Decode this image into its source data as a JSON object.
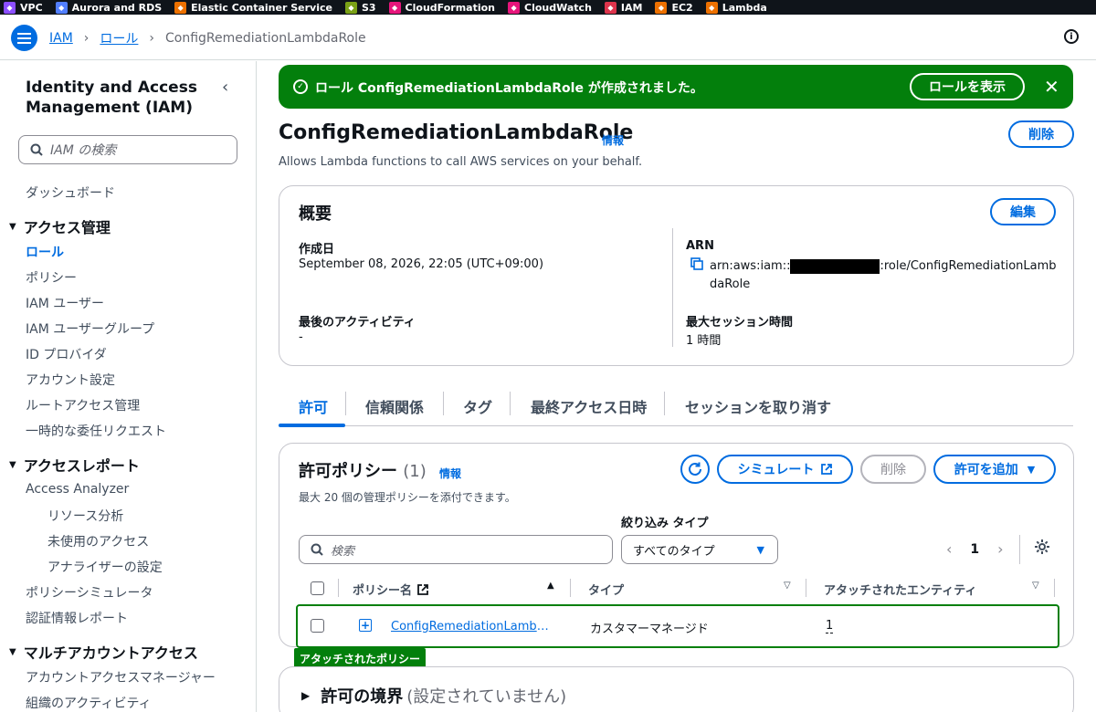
{
  "services": [
    {
      "name": "VPC",
      "color": "#8c4fff",
      "icon": "vpc-icon"
    },
    {
      "name": "Aurora and RDS",
      "color": "#527fff",
      "icon": "rds-icon"
    },
    {
      "name": "Elastic Container Service",
      "color": "#ed7100",
      "icon": "ecs-icon"
    },
    {
      "name": "S3",
      "color": "#7aa116",
      "icon": "s3-icon"
    },
    {
      "name": "CloudFormation",
      "color": "#e7157b",
      "icon": "cloudformation-icon"
    },
    {
      "name": "CloudWatch",
      "color": "#e7157b",
      "icon": "cloudwatch-icon"
    },
    {
      "name": "IAM",
      "color": "#dd344c",
      "icon": "iam-icon"
    },
    {
      "name": "EC2",
      "color": "#ed7100",
      "icon": "ec2-icon"
    },
    {
      "name": "Lambda",
      "color": "#ed7100",
      "icon": "lambda-icon"
    }
  ],
  "breadcrumb": {
    "iam": "IAM",
    "roles": "ロール",
    "current": "ConfigRemediationLambdaRole"
  },
  "sidebar": {
    "title": "Identity and Access Management (IAM)",
    "search_placeholder": "IAM の検索",
    "dashboard": "ダッシュボード",
    "access_mgmt": {
      "header": "アクセス管理",
      "items": [
        "ロール",
        "ポリシー",
        "IAM ユーザー",
        "IAM ユーザーグループ",
        "ID プロバイダ",
        "アカウント設定",
        "ルートアクセス管理",
        "一時的な委任リクエスト"
      ]
    },
    "access_reports": {
      "header": "アクセスレポート",
      "analyzer": "Access Analyzer",
      "analyzer_items": [
        "リソース分析",
        "未使用のアクセス",
        "アナライザーの設定"
      ],
      "items": [
        "ポリシーシミュレータ",
        "認証情報レポート"
      ]
    },
    "multi_account": {
      "header": "マルチアカウントアクセス",
      "items": [
        "アカウントアクセスマネージャー",
        "組織のアクティビティ"
      ]
    }
  },
  "flash": {
    "message": "ロール ConfigRemediationLambdaRole が作成されました。",
    "view_button": "ロールを表示",
    "color": "#037f0c"
  },
  "role": {
    "name": "ConfigRemediationLambdaRole",
    "info": "情報",
    "description": "Allows Lambda functions to call AWS services on your behalf.",
    "delete_button": "削除"
  },
  "summary": {
    "title": "概要",
    "edit_button": "編集",
    "created_label": "作成日",
    "created_value": "September 08, 2026, 22:05 (UTC+09:00)",
    "arn_label": "ARN",
    "arn_prefix": "arn:aws:iam::",
    "arn_suffix": ":role/ConfigRemediationLamb",
    "arn_suffix2": "daRole",
    "last_activity_label": "最後のアクティビティ",
    "last_activity_value": "-",
    "max_session_label": "最大セッション時間",
    "max_session_value": "1 時間"
  },
  "tabs": [
    "許可",
    "信頼関係",
    "タグ",
    "最終アクセス日時",
    "セッションを取り消す"
  ],
  "policies": {
    "title": "許可ポリシー",
    "count": "(1)",
    "info": "情報",
    "description": "最大 20 個の管理ポリシーを添付できます。",
    "simulate_button": "シミュレート",
    "delete_button": "削除",
    "add_button": "許可を追加",
    "filter_label": "絞り込み タイプ",
    "search_placeholder": "検索",
    "type_select": "すべてのタイプ",
    "page": "1",
    "columns": [
      "ポリシー名",
      "タイプ",
      "アタッチされたエンティティ"
    ],
    "row": {
      "name": "ConfigRemediationLambdaPolicy",
      "type": "カスタマーマネージド",
      "entities": "1"
    },
    "attached_tag": "アタッチされたポリシー"
  },
  "boundary": {
    "title": "許可の境界",
    "status": "(設定されていません)"
  },
  "colors": {
    "primary": "#006ce0",
    "success": "#037f0c",
    "text": "#0f141a"
  }
}
